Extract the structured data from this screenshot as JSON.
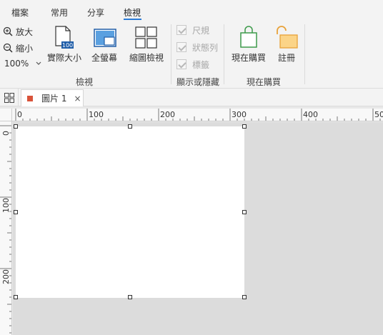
{
  "menu": [
    "檔案",
    "常用",
    "分享",
    "檢視"
  ],
  "active_menu": "檢視",
  "ribbon": {
    "view_group": {
      "zoom_in": "放大",
      "zoom_out": "縮小",
      "zoom_level": "100%",
      "actual_size": "實際大小",
      "actual_size_badge": "100",
      "fullscreen": "全螢幕",
      "thumbnail": "縮圖檢視",
      "label": "檢視"
    },
    "show_hide_group": {
      "ruler": "尺規",
      "statusbar": "狀態列",
      "tabs": "標籤",
      "label": "顯示或隱藏"
    },
    "buy_group": {
      "buy_now": "現在購買",
      "register": "註冊",
      "label": "現在購買"
    }
  },
  "tab": {
    "title": "圖片 1",
    "close": "×"
  },
  "ruler": {
    "h_labels": [
      "0",
      "100",
      "200",
      "300",
      "400",
      "50"
    ],
    "v_labels": [
      "0",
      "100",
      "200"
    ]
  },
  "colors": {
    "accent": "#2b7bd6",
    "tab_dot": "#d9533a",
    "buy_green": "#3c9a4a",
    "register_orange": "#e8a23a"
  }
}
